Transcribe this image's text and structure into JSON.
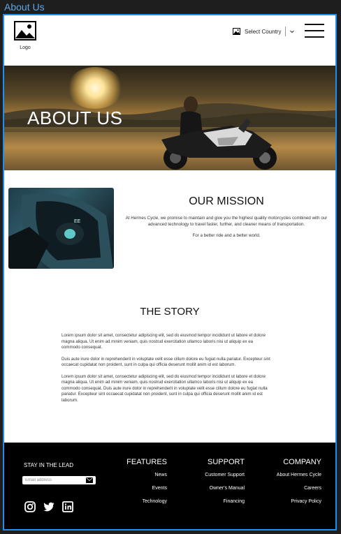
{
  "frame_label": "About Us",
  "header": {
    "logo_label": "Logo",
    "country_select": "Select Country"
  },
  "hero": {
    "title": "ABOUT US"
  },
  "mission": {
    "title": "OUR MISSION",
    "text": "At Hermes Cycle, we promise to maintain and give you the highest quality motorcycles combined with our advanced technology to travel faster, further, and cleaner means of transportation.",
    "tagline": "For a better ride and a better world."
  },
  "story": {
    "title": "THE STORY",
    "paragraphs": [
      "Lorem ipsum dolor sit amet, consectetur adipiscing elit, sed do eiusmod tempor incididunt ut labore et dolore magna aliqua. Ut enim ad minim veniam, quis nostrud exercitation ullamco laboris nisi ut aliquip ex ea commodo consequat.",
      " Duis aute irure dolor in reprehenderit in voluptate velit esse cillum dolore eu fugiat nulla pariatur. Excepteur sint occaecat cupidatat non proident, sunt in culpa qui officia deserunt mollit anim id est laborum.",
      "Lorem ipsum dolor sit amet, consectetur adipiscing elit, sed do eiusmod tempor incididunt ut labore et dolore magna aliqua. Ut enim ad minim veniam, quis nostrud exercitation ullamco laboris nisi ut aliquip ex ea commodo consequat. Duis aute irure dolor in reprehenderit in voluptate velit esse cillum dolore eu fugiat nulla pariatur. Excepteur sint occaecat cupidatat non proident, sunt in culpa qui officia deserunt mollit anim id est laborum."
    ]
  },
  "footer": {
    "lead_label": "STAY IN THE LEAD",
    "email_placeholder": "Email address",
    "socials": [
      "instagram-icon",
      "twitter-icon",
      "linkedin-icon"
    ],
    "features": {
      "heading": "FEATURES",
      "links": [
        "News",
        "Events",
        "Technology"
      ]
    },
    "support": {
      "heading": "SUPPORT",
      "links": [
        "Customer Support",
        "Owner's Manual",
        "Financing"
      ]
    },
    "company": {
      "heading": "COMPANY",
      "links": [
        "About Hermes Cycle",
        "Careers",
        "Privacy Policy"
      ]
    }
  },
  "colors": {
    "frame_border": "#1e8ff0",
    "footer_bg": "#000000",
    "label": "#5fa8e6"
  }
}
